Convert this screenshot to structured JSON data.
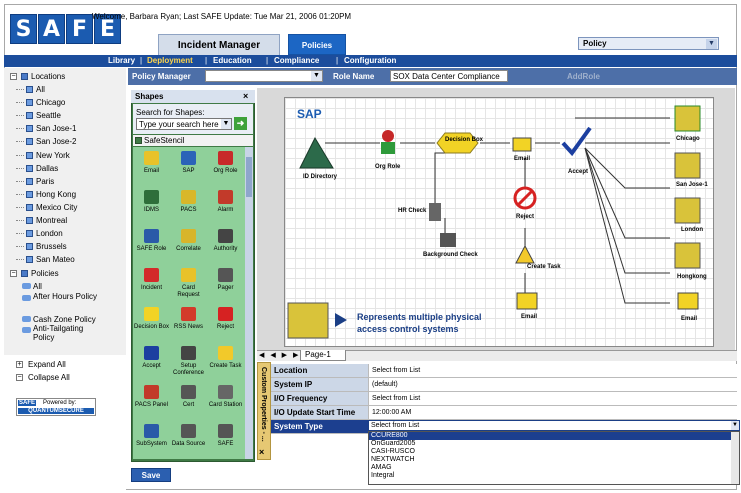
{
  "app": {
    "logo_letters": [
      "S",
      "A",
      "F",
      "E"
    ],
    "welcome": "Welcome, Barbara Ryan; Last SAFE Update: Tue Mar 21, 2006 01:20PM",
    "tabs": [
      "Incident Manager",
      "Policies"
    ],
    "active_tab": "Policies",
    "policy_select": "Policy"
  },
  "nav": {
    "items": [
      "Library",
      "Deployment",
      "Education",
      "Compliance",
      "Configuration"
    ],
    "active": "Deployment"
  },
  "toolbar": {
    "policy_manager_label": "Policy Manager",
    "role_name_label": "Role Name",
    "role_name_value": "SOX Data Center Compliance",
    "add_role": "AddRole"
  },
  "tree": {
    "locations_label": "Locations",
    "locations": [
      "All",
      "Chicago",
      "Seattle",
      "San Jose-1",
      "San Jose-2",
      "New York",
      "Dallas",
      "Paris",
      "Hong Kong",
      "Mexico City",
      "Montreal",
      "London",
      "Brussels",
      "San Mateo"
    ],
    "policies_label": "Policies",
    "policies": [
      "All",
      "After Hours Policy",
      "Cash Zone Policy",
      "Anti-Tailgating Policy"
    ],
    "expand_all": "Expand All",
    "collapse_all": "Collapse All",
    "vendor_top": "SAFE",
    "powered_by": "Powered by:",
    "vendor_bottom": "QUANTUMSECURE"
  },
  "shapes": {
    "title": "Shapes",
    "close": "×",
    "search_label": "Search for Shapes:",
    "search_placeholder": "Type your search here",
    "stencil": "SafeStencil",
    "items": [
      {
        "label": "Email",
        "icon": "email-icon",
        "color": "#e8c22a"
      },
      {
        "label": "SAP",
        "icon": "sap-icon",
        "color": "#2b63b8"
      },
      {
        "label": "Org Role",
        "icon": "org-role-icon",
        "color": "#c72a2a"
      },
      {
        "label": "IDMS",
        "icon": "idms-icon",
        "color": "#2e6e3a"
      },
      {
        "label": "PACS",
        "icon": "pacs-icon",
        "color": "#d9b72a"
      },
      {
        "label": "Alarm",
        "icon": "alarm-icon",
        "color": "#c23a2a"
      },
      {
        "label": "SAFE Role",
        "icon": "safe-role-icon",
        "color": "#2a5aa8"
      },
      {
        "label": "Correlate",
        "icon": "correlate-icon",
        "color": "#d8b52a"
      },
      {
        "label": "Authority",
        "icon": "authority-icon",
        "color": "#444444"
      },
      {
        "label": "Incident",
        "icon": "incident-icon",
        "color": "#d32a2a"
      },
      {
        "label": "Card Request",
        "icon": "card-request-icon",
        "color": "#e8c22a"
      },
      {
        "label": "Pager",
        "icon": "pager-icon",
        "color": "#555555"
      },
      {
        "label": "Decision Box",
        "icon": "decision-box-icon",
        "color": "#f2d325"
      },
      {
        "label": "RSS News",
        "icon": "rss-news-icon",
        "color": "#d33a2a"
      },
      {
        "label": "Reject",
        "icon": "reject-icon",
        "color": "#d62222"
      },
      {
        "label": "Accept",
        "icon": "accept-icon",
        "color": "#1c3fa0"
      },
      {
        "label": "Setup Conference",
        "icon": "conference-icon",
        "color": "#444444"
      },
      {
        "label": "Create Task",
        "icon": "create-task-icon",
        "color": "#f2c92a"
      },
      {
        "label": "PACS Panel",
        "icon": "pacs-panel-icon",
        "color": "#c23a2a"
      },
      {
        "label": "Cert",
        "icon": "cert-icon",
        "color": "#555555"
      },
      {
        "label": "Card Station",
        "icon": "card-station-icon",
        "color": "#666666"
      },
      {
        "label": "SubSystem",
        "icon": "subsystem-icon",
        "color": "#2a5aa8"
      },
      {
        "label": "Data Source",
        "icon": "data-source-icon",
        "color": "#555555"
      },
      {
        "label": "SAFE",
        "icon": "safe-icon",
        "color": "#555555"
      }
    ],
    "save": "Save"
  },
  "diagram": {
    "sap_label": "SAP",
    "nodes": [
      "ID Directory",
      "Org Role",
      "Decision Box",
      "Email",
      "Accept",
      "Reject",
      "HR Check",
      "Background Check",
      "Create Task",
      "Email",
      "Chicago",
      "San Jose-1",
      "London",
      "Hongkong",
      "Email"
    ],
    "annotation_line1": "Represents multiple physical",
    "annotation_line2": "access control systems"
  },
  "pages": {
    "arrows": "◀ ◀ ▶ ▶|",
    "current": "Page-1"
  },
  "properties": {
    "side_label": "Custom Properties - ...",
    "close": "×",
    "rows": [
      {
        "key": "Location",
        "value": "Select from List"
      },
      {
        "key": "System IP",
        "value": "(default)"
      },
      {
        "key": "I/O Frequency",
        "value": "Select from List"
      },
      {
        "key": "I/O Update Start Time",
        "value": "12:00:00 AM"
      },
      {
        "key": "System Type",
        "value": ""
      }
    ],
    "system_type_selected": "Select from List",
    "system_type_options": [
      "CCURE800",
      "OnGuard2005",
      "CASI-RUSCO",
      "NEXTWATCH",
      "AMAG",
      "Integral"
    ],
    "highlighted_option": "CCURE800"
  }
}
